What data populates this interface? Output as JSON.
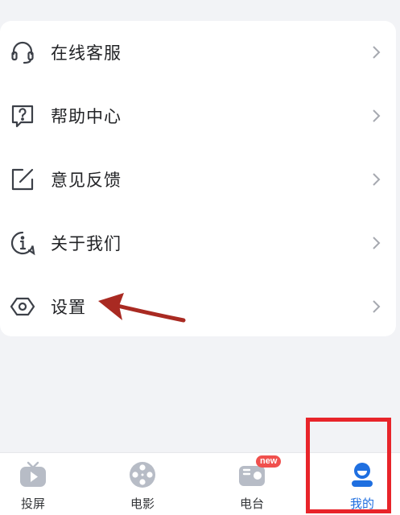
{
  "menu": {
    "items": [
      {
        "label": "在线客服",
        "icon": "headset-icon"
      },
      {
        "label": "帮助中心",
        "icon": "help-question-icon"
      },
      {
        "label": "意见反馈",
        "icon": "edit-feedback-icon"
      },
      {
        "label": "关于我们",
        "icon": "info-icon"
      },
      {
        "label": "设置",
        "icon": "settings-hexagon-icon"
      }
    ]
  },
  "tabbar": {
    "tabs": [
      {
        "label": "投屏",
        "icon": "tv-cast-icon"
      },
      {
        "label": "电影",
        "icon": "film-reel-icon"
      },
      {
        "label": "电台",
        "icon": "radio-icon",
        "badge": "new"
      },
      {
        "label": "我的",
        "icon": "profile-icon",
        "active": true
      }
    ]
  },
  "colors": {
    "accent": "#1f6fe0",
    "annotation_red": "#e8242a",
    "arrow_red": "#a92a22",
    "icon_gray": "#b7bcc6"
  }
}
